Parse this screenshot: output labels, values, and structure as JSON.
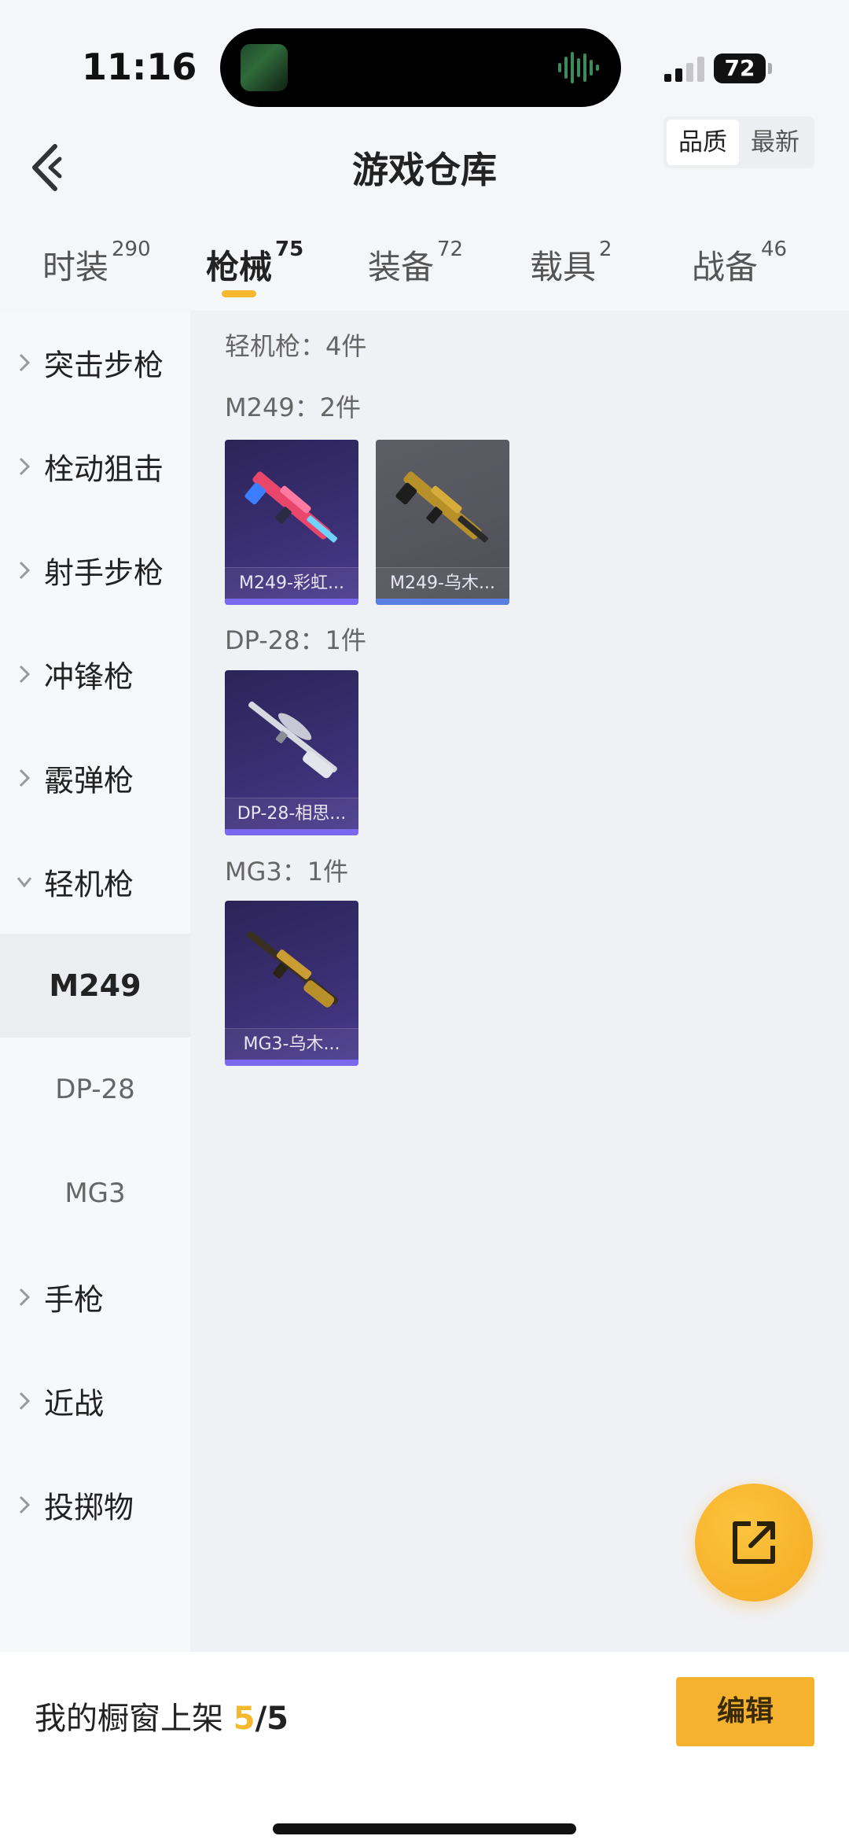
{
  "status_bar": {
    "time": "11:16",
    "battery": "72"
  },
  "header": {
    "title": "游戏仓库",
    "sort_options": [
      "品质",
      "最新"
    ]
  },
  "tabs": [
    {
      "label": "时装",
      "count": "290"
    },
    {
      "label": "枪械",
      "count": "75"
    },
    {
      "label": "装备",
      "count": "72"
    },
    {
      "label": "载具",
      "count": "2"
    },
    {
      "label": "战备",
      "count": "46"
    }
  ],
  "sidebar": {
    "items": [
      "突击步枪",
      "栓动狙击",
      "射手步枪",
      "冲锋枪",
      "霰弹枪",
      "轻机枪"
    ],
    "sub_items": [
      "M249",
      "DP-28",
      "MG3"
    ],
    "items_after": [
      "手枪",
      "近战",
      "投掷物"
    ]
  },
  "content": {
    "category_header": "轻机枪：4件",
    "groups": [
      {
        "title": "M249：2件",
        "cards": [
          "M249-彩虹...",
          "M249-乌木..."
        ]
      },
      {
        "title": "DP-28：1件",
        "cards": [
          "DP-28-相思..."
        ]
      },
      {
        "title": "MG3：1件",
        "cards": [
          "MG3-乌木..."
        ]
      }
    ]
  },
  "bottom": {
    "showcase_label": "我的橱窗上架 ",
    "showcase_count": "5",
    "showcase_total": "/5",
    "edit_label": "编辑"
  },
  "colors": {
    "accent": "#f5b82e",
    "card_purple": "#3a2f73",
    "card_gray": "#55555e"
  },
  "icons": {
    "back": "back-chevron-icon",
    "fab": "share-external-icon",
    "chevron": "chevron-right-icon"
  }
}
